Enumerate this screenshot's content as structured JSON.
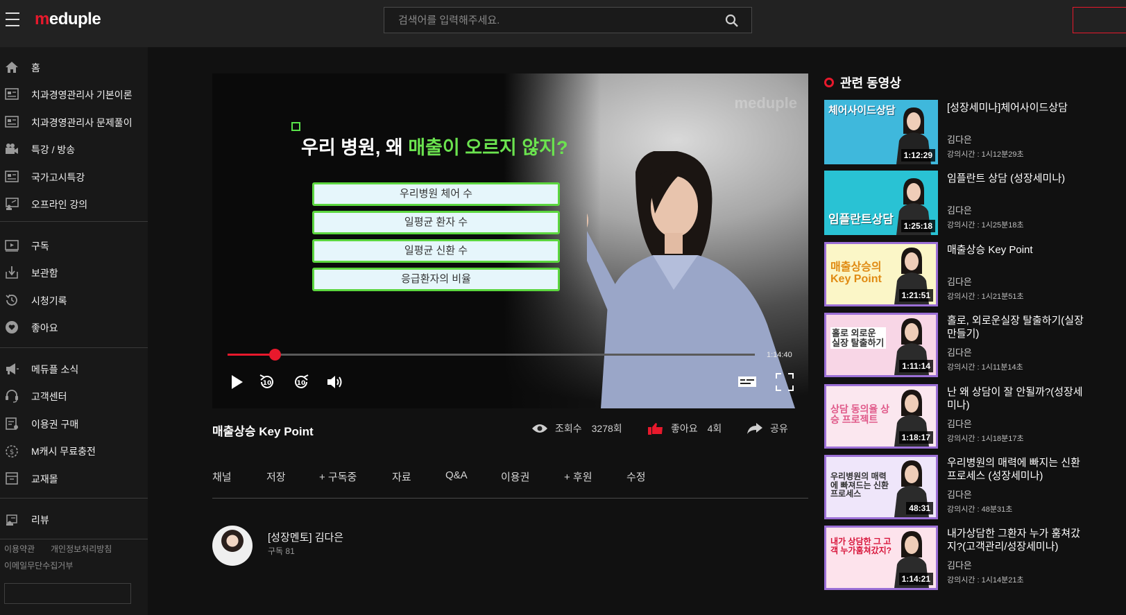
{
  "brand": {
    "logo_prefix": "m",
    "logo_rest": "eduple"
  },
  "search": {
    "placeholder": "검색어를 입력해주세요."
  },
  "sidebar": {
    "items": [
      {
        "label": "홈",
        "icon": "home-icon"
      },
      {
        "label": "치과경영관리사 기본이론",
        "icon": "lecture-icon"
      },
      {
        "label": "치과경영관리사 문제풀이",
        "icon": "lecture-icon"
      },
      {
        "label": "특강 / 방송",
        "icon": "camera-icon"
      },
      {
        "label": "국가고시특강",
        "icon": "lecture-icon"
      },
      {
        "label": "오프라인 강의",
        "icon": "classroom-icon"
      },
      {
        "label": "구독",
        "icon": "subscribe-icon"
      },
      {
        "label": "보관함",
        "icon": "download-icon"
      },
      {
        "label": "시청기록",
        "icon": "history-icon"
      },
      {
        "label": "좋아요",
        "icon": "heart-icon"
      },
      {
        "label": "메듀플 소식",
        "icon": "megaphone-icon"
      },
      {
        "label": "고객센터",
        "icon": "headset-icon"
      },
      {
        "label": "이용권 구매",
        "icon": "ticket-icon"
      },
      {
        "label": "M캐시 무료충전",
        "icon": "coin-icon"
      },
      {
        "label": "교재몰",
        "icon": "book-icon"
      },
      {
        "label": "리뷰",
        "icon": "review-icon"
      }
    ],
    "footer": {
      "terms": "이용약관",
      "privacy": "개인정보처리방침",
      "email": "이메일무단수집거부"
    }
  },
  "player": {
    "slide_title_prefix": "우리 병원, 왜 ",
    "slide_title_highlight": "매출이 오르지 않지?",
    "slide_items": [
      "우리병원 체어 수",
      "일평균 환자 수",
      "일평균 신환 수",
      "응급환자의 비율"
    ],
    "watermark": "meduple",
    "time_remaining": "1:14:40",
    "progress": 0.09
  },
  "video": {
    "title": "매출상승 Key Point",
    "views_label": "조회수",
    "views": "3278회",
    "likes_label": "좋아요",
    "likes": "4회",
    "share_label": "공유"
  },
  "tabs": [
    "채널",
    "저장",
    "+ 구독중",
    "자료",
    "Q&A",
    "이용권",
    "+ 후원",
    "수정"
  ],
  "channel": {
    "name": "[성장멘토] 김다은",
    "subs": "구독 81"
  },
  "related": {
    "heading": "관련 동영상",
    "items": [
      {
        "title": "[성장세미나]체어사이드상담",
        "author": "김다은",
        "duration_text": "강의시간 : 1시12분29초",
        "thumb_duration": "1:12:29",
        "thumb_text": "체어사이드상담",
        "thumb_bg": "#3fb8dc"
      },
      {
        "title": "임플란트 상담 (성장세미나)",
        "author": "김다은",
        "duration_text": "강의시간 : 1시25분18초",
        "thumb_duration": "1:25:18",
        "thumb_text": "임플란트상담",
        "thumb_bg": "#29c2d4"
      },
      {
        "title": "매출상승 Key Point",
        "author": "김다은",
        "duration_text": "강의시간 : 1시21분51초",
        "thumb_duration": "1:21:51",
        "thumb_text": "매출상승의 Key Point",
        "thumb_bg": "#fbf6c7"
      },
      {
        "title": "홀로, 외로운실장 탈출하기(실장만들기)",
        "author": "김다은",
        "duration_text": "강의시간 : 1시11분14초",
        "thumb_duration": "1:11:14",
        "thumb_text": "홀로 외로운 실장 탈출하기",
        "thumb_bg": "#f8d6e6"
      },
      {
        "title": "난 왜 상담이 잘 안될까?(성장세미나)",
        "author": "김다은",
        "duration_text": "강의시간 : 1시18분17초",
        "thumb_duration": "1:18:17",
        "thumb_text": "상담 동의율 상승 프로젝트",
        "thumb_bg": "#fbe7ef"
      },
      {
        "title": "우리병원의 매력에 빠지는 신환프로세스 (성장세미나)",
        "author": "김다은",
        "duration_text": "강의시간 : 48분31초",
        "thumb_duration": "48:31",
        "thumb_text": "우리병원의 매력에 빠져드는 신환 프로세스",
        "thumb_bg": "#efe6fa"
      },
      {
        "title": "내가상담한 그환자 누가 훔쳐갔지?(고객관리/성장세미나)",
        "author": "김다은",
        "duration_text": "강의시간 : 1시14분21초",
        "thumb_duration": "1:14:21",
        "thumb_text": "내가 상담한 그 고객 누가훔쳐갔지?",
        "thumb_bg": "#fde3ec"
      }
    ]
  },
  "colors": {
    "accent": "#e8192c",
    "slide_green": "#6be34f",
    "thumb_border": "#9b6fd6"
  }
}
